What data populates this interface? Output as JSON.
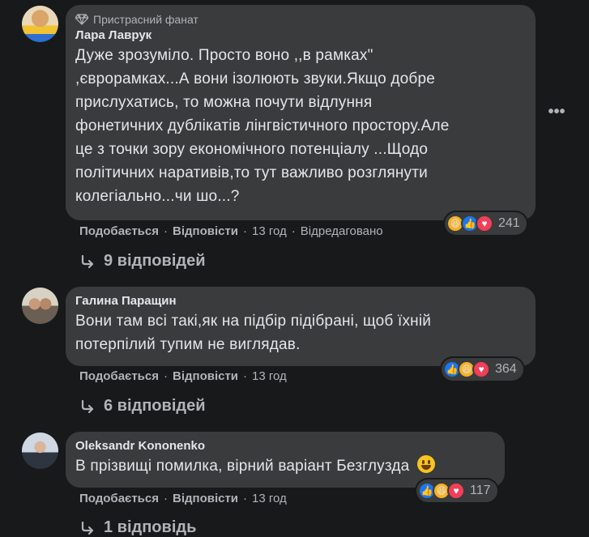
{
  "comments": [
    {
      "badge": "Пристрасний фанат",
      "author": "Лара Лаврук",
      "text": "Дуже зрозуміло. Просто воно ,,в рамках\"\n,єврорамках...А вони ізолюють звуки.Якщо добре\nприслухатись, то можна почути відлуння\nфонетичних дублікатів лінгвістичного простору.Але\nце з точки зору економічного потенціалу ...Щодо\nполітичних наративів,то тут важливо розглянути\nколегіально...чи шо...?",
      "like_label": "Подобається",
      "reply_label": "Відповісти",
      "time": "13 год",
      "edited": "Відредаговано",
      "reaction_count": "241",
      "replies_label": "9 відповідей"
    },
    {
      "author": "Галина Паращин",
      "text": "Вони там всі такі,як на підбір підібрані, щоб їхній\nпотерпілий тупим не виглядав.",
      "like_label": "Подобається",
      "reply_label": "Відповісти",
      "time": "13 год",
      "reaction_count": "364",
      "replies_label": "6 відповідей"
    },
    {
      "author": "Oleksandr Kononenko",
      "text": "В прізвищі помилка, вірний варіант Безглузда",
      "like_label": "Подобається",
      "reply_label": "Відповісти",
      "time": "13 год",
      "reaction_count": "117",
      "replies_label": "1 відповідь"
    }
  ],
  "icons": {
    "more": "more-horizontal-icon",
    "badge": "diamond-icon",
    "reply_arrow": "reply-arrow-icon"
  },
  "colors": {
    "background": "#18191a",
    "bubble": "#3a3b3c",
    "text": "#e4e6eb",
    "secondary": "#b0b3b8",
    "like_blue": "#1877f2",
    "love_red": "#f33e58",
    "haha_yellow": "#f7b125"
  }
}
